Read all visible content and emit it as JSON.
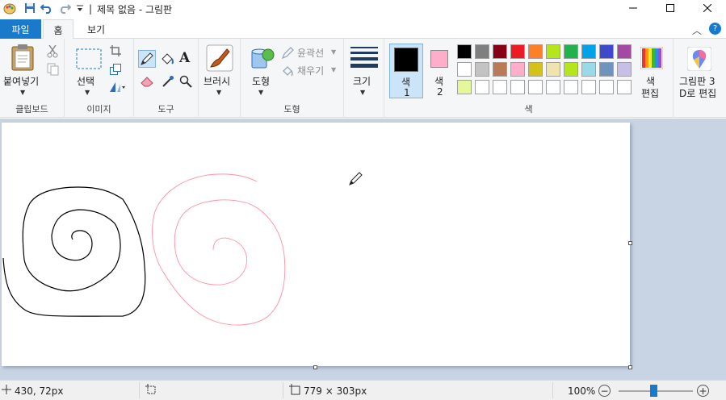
{
  "title_bar": {
    "document_title": "제목 없음 - 그림판",
    "separator": "|",
    "icons": [
      "paint-app-icon",
      "save-icon",
      "undo-icon",
      "redo-icon",
      "customize-quick-access-icon"
    ],
    "window_controls": [
      "minimize-icon",
      "maximize-icon",
      "close-icon"
    ]
  },
  "tabs": {
    "file": "파일",
    "home": "홈",
    "view": "보기",
    "help": "?"
  },
  "ribbon": {
    "clipboard": {
      "paste": "붙여넣기",
      "group": "클립보드"
    },
    "image": {
      "select": "선택",
      "group": "이미지"
    },
    "tools": {
      "group": "도구"
    },
    "brushes": {
      "label": "브러시"
    },
    "shapes": {
      "shape": "도형",
      "outline": "윤곽선",
      "fill": "채우기",
      "group": "도형"
    },
    "size": {
      "label": "크기"
    },
    "colors": {
      "color1_line1": "색",
      "color1_line2": "1",
      "color2_line1": "색",
      "color2_line2": "2",
      "edit_line1": "색",
      "edit_line2": "편집",
      "group": "색",
      "color1_value": "#000000",
      "color2_value": "#ffaec9",
      "palette_row1": [
        "#000000",
        "#7f7f7f",
        "#880015",
        "#ed1c24",
        "#ff7f27",
        "#b5e61d",
        "#22b14c",
        "#00a2e8",
        "#3f48cc",
        "#a349a4"
      ],
      "palette_row2": [
        "#ffffff",
        "#c3c3c3",
        "#b97a57",
        "#ffaec9",
        "#d4c21a",
        "#efe4b0",
        "#b5e61d",
        "#99d9ea",
        "#7092be",
        "#c8bfe7"
      ],
      "palette_row3": [
        "#e4f79b",
        "#ffffff",
        "#ffffff",
        "#ffffff",
        "#ffffff",
        "#ffffff",
        "#ffffff",
        "#ffffff",
        "#ffffff",
        "#ffffff"
      ]
    },
    "paint3d": {
      "line1": "그림판 3",
      "line2": "D로 편집"
    }
  },
  "canvas": {
    "stroke_black": "#000000",
    "stroke_pink": "#ff8fa0"
  },
  "status": {
    "cursor_pos": "430, 72px",
    "canvas_size": "779 × 303px",
    "zoom": "100%",
    "zoom_level_fraction": 0.5
  }
}
